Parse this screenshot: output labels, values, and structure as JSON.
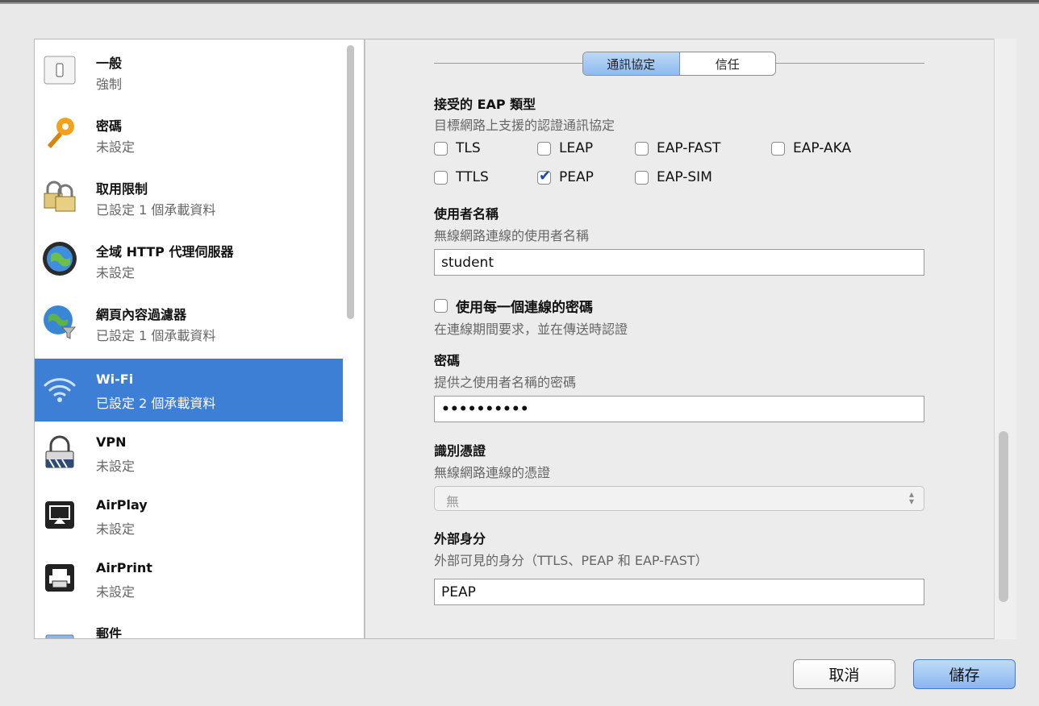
{
  "sidebar": {
    "items": [
      {
        "title": "一般",
        "subtitle": "強制",
        "icon": "general-switch-icon"
      },
      {
        "title": "密碼",
        "subtitle": "未設定",
        "icon": "key-icon"
      },
      {
        "title": "取用限制",
        "subtitle": "已設定 1 個承載資料",
        "icon": "padlocks-icon"
      },
      {
        "title": "全域 HTTP 代理伺服器",
        "subtitle": "未設定",
        "icon": "globe-icon"
      },
      {
        "title": "網頁內容過濾器",
        "subtitle": "已設定 1 個承載資料",
        "icon": "globe-filter-icon"
      },
      {
        "title": "Wi-Fi",
        "subtitle": "已設定 2 個承載資料",
        "icon": "wifi-icon",
        "selected": true
      },
      {
        "title": "VPN",
        "subtitle": "未設定",
        "icon": "vpn-lock-icon"
      },
      {
        "title": "AirPlay",
        "subtitle": "未設定",
        "icon": "airplay-icon"
      },
      {
        "title": "AirPrint",
        "subtitle": "未設定",
        "icon": "printer-icon"
      },
      {
        "title": "郵件",
        "subtitle": "",
        "icon": "mail-icon"
      }
    ]
  },
  "tabs": {
    "protocol": "通訊協定",
    "trust": "信任"
  },
  "eap": {
    "title": "接受的 EAP 類型",
    "desc": "目標網路上支援的認證通訊協定",
    "options": {
      "tls": "TLS",
      "leap": "LEAP",
      "eap_fast": "EAP-FAST",
      "eap_aka": "EAP-AKA",
      "ttls": "TTLS",
      "peap": "PEAP",
      "eap_sim": "EAP-SIM"
    }
  },
  "username": {
    "title": "使用者名稱",
    "desc": "無線網路連線的使用者名稱",
    "value": "student"
  },
  "per_connection": {
    "label": "使用每一個連線的密碼",
    "desc": "在連線期間要求，並在傳送時認證"
  },
  "password": {
    "title": "密碼",
    "desc": "提供之使用者名稱的密碼",
    "value": "••••••••••"
  },
  "identity_cert": {
    "title": "識別憑證",
    "desc": "無線網路連線的憑證",
    "value": "無"
  },
  "outer_identity": {
    "title": "外部身分",
    "desc": "外部可見的身分（TTLS、PEAP 和 EAP-FAST）",
    "value": "PEAP"
  },
  "footer": {
    "cancel": "取消",
    "save": "儲存"
  },
  "colors": {
    "selection": "#3e7fd6",
    "accent": "#8ab6ee"
  }
}
